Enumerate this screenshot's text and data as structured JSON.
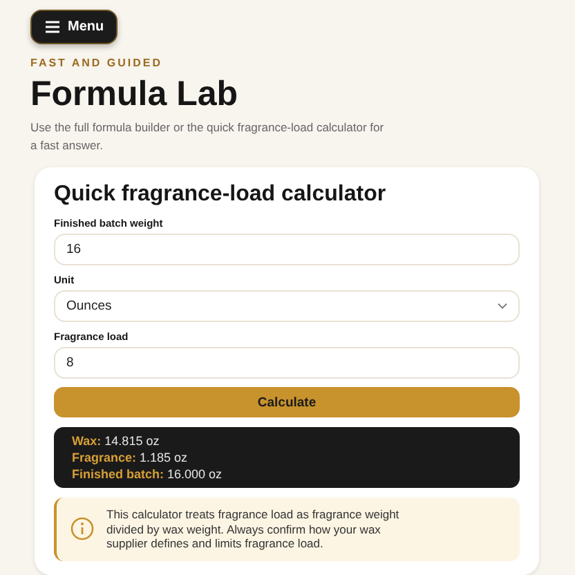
{
  "menu_button": {
    "label": "Menu"
  },
  "kicker": "FAST AND GUIDED",
  "title": "Formula Lab",
  "subtitle": "Use the full formula builder or the quick fragrance-load calculator for a fast answer.",
  "card": {
    "title": "Quick fragrance-load calculator",
    "fields": [
      {
        "kind": "input",
        "label": "Finished batch weight",
        "value": "16"
      },
      {
        "kind": "select",
        "label": "Unit",
        "value": "Ounces"
      },
      {
        "kind": "input",
        "label": "Fragrance load",
        "value": "8"
      }
    ],
    "button": "Calculate",
    "results": [
      "**Wax:** 14.815 oz",
      "**Fragrance:** 1.185 oz",
      "**Finished batch:** 16.000 oz"
    ],
    "note": "This calculator treats fragrance load as fragrance weight divided by wax weight. Always confirm how your wax supplier defines and limits fragrance load."
  }
}
